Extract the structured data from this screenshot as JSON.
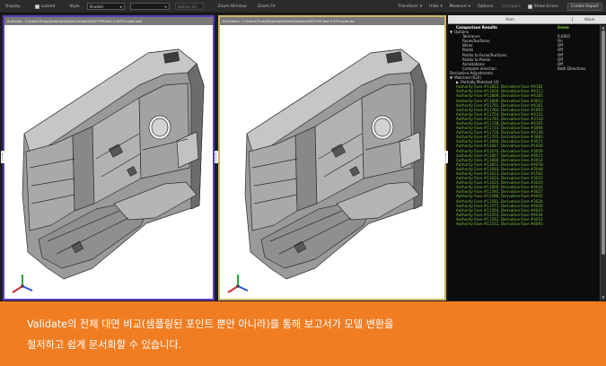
{
  "toolbar": {
    "display_label": "Display",
    "locked_label": "Locked",
    "style_label": "Style",
    "style_value": "Shaded",
    "empty_select_value": "",
    "fixed_label": "Setting 1D",
    "zoom_window_label": "Zoom Window",
    "zoom_fit_label": "Zoom Fit",
    "transform_label": "Transform",
    "hide_label": "Hide",
    "measure_label": "Measure",
    "options_label": "Options",
    "compare_label": "Compare",
    "show_errors_label": "Show Errors",
    "create_report_label": "Create Report"
  },
  "viewports": {
    "left_title": "Authority - C:\\Users\\Trudy\\Desktop\\Models\\Validate\\NIST-PMI-Test-5-AUTH-code.asm",
    "right_title": "Derivative - C:\\Users\\Trudy\\Desktop\\Models\\Validate\\NIST-PMI-Test-5-STP-code.stp"
  },
  "panel": {
    "header_item": "Item",
    "header_value": "Value",
    "rows": [
      {
        "k": "Comparison Results",
        "v": "Same",
        "level": 1,
        "style": "bold",
        "vstyle": "same",
        "exp": ""
      },
      {
        "k": "Options",
        "v": "",
        "level": 0,
        "style": "",
        "exp": "▼"
      },
      {
        "k": "Tolerance",
        "v": "0.0001",
        "level": 2,
        "style": "",
        "exp": ""
      },
      {
        "k": "Faces/Surfaces",
        "v": "On",
        "level": 2,
        "style": "",
        "exp": ""
      },
      {
        "k": "Wires",
        "v": "Off",
        "level": 2,
        "style": "",
        "exp": ""
      },
      {
        "k": "Points",
        "v": "Off",
        "level": 2,
        "style": "",
        "exp": ""
      },
      {
        "k": "Points to Faces/Surfaces",
        "v": "Off",
        "level": 2,
        "style": "",
        "exp": ""
      },
      {
        "k": "Points to Points",
        "v": "Off",
        "level": 2,
        "style": "",
        "exp": ""
      },
      {
        "k": "Annotations",
        "v": "Off",
        "level": 2,
        "style": "",
        "exp": ""
      },
      {
        "k": "Compare direction",
        "v": "Both Directions",
        "level": 2,
        "style": "",
        "exp": ""
      },
      {
        "k": "Derivative Adjustments",
        "v": "",
        "level": 0,
        "style": "",
        "exp": ""
      },
      {
        "k": "Matched (622)",
        "v": "",
        "level": 0,
        "style": "",
        "exp": "▼"
      },
      {
        "k": "Partially Matched (4)",
        "v": "",
        "level": 1,
        "style": "",
        "exp": "▶"
      },
      {
        "k": "Authority Face #11823, Derivative Face #4181",
        "v": "",
        "level": 1,
        "style": "green",
        "exp": ""
      },
      {
        "k": "Authority Face #11816, Derivative Face #4113",
        "v": "",
        "level": 1,
        "style": "green",
        "exp": ""
      },
      {
        "k": "Authority Face #11809, Derivative Face #4185",
        "v": "",
        "level": 1,
        "style": "green",
        "exp": ""
      },
      {
        "k": "Authority Face #11800, Derivative Face #3623",
        "v": "",
        "level": 1,
        "style": "green",
        "exp": ""
      },
      {
        "k": "Authority Face #11791, Derivative Face #4161",
        "v": "",
        "level": 1,
        "style": "green",
        "exp": ""
      },
      {
        "k": "Authority Face #11784, Derivative Face #1663",
        "v": "",
        "level": 1,
        "style": "green",
        "exp": ""
      },
      {
        "k": "Authority Face #11754, Derivative Face #4152",
        "v": "",
        "level": 1,
        "style": "green",
        "exp": ""
      },
      {
        "k": "Authority Face #11745, Derivative Face #3118",
        "v": "",
        "level": 1,
        "style": "green",
        "exp": ""
      },
      {
        "k": "Authority Face #11738, Derivative Face #4165",
        "v": "",
        "level": 1,
        "style": "green",
        "exp": ""
      },
      {
        "k": "Authority Face #11733, Derivative Face #3094",
        "v": "",
        "level": 1,
        "style": "green",
        "exp": ""
      },
      {
        "k": "Authority Face #11726, Derivative Face #4148",
        "v": "",
        "level": 1,
        "style": "green",
        "exp": ""
      },
      {
        "k": "Authority Face #11705, Derivative Face #3083",
        "v": "",
        "level": 1,
        "style": "green",
        "exp": ""
      },
      {
        "k": "Authority Face #11696, Derivative Face #3071",
        "v": "",
        "level": 1,
        "style": "green",
        "exp": ""
      },
      {
        "k": "Authority Face #11687, Derivative Face #1036",
        "v": "",
        "level": 1,
        "style": "green",
        "exp": ""
      },
      {
        "k": "Authority Face #11676, Derivative Face #3059",
        "v": "",
        "level": 1,
        "style": "green",
        "exp": ""
      },
      {
        "k": "Authority Face #11667, Derivative Face #4071",
        "v": "",
        "level": 1,
        "style": "green",
        "exp": ""
      },
      {
        "k": "Authority Face #11660, Derivative Face #3014",
        "v": "",
        "level": 1,
        "style": "green",
        "exp": ""
      },
      {
        "k": "Authority Face #11651, Derivative Face #4078",
        "v": "",
        "level": 1,
        "style": "green",
        "exp": ""
      },
      {
        "k": "Authority Face #11640, Derivative Face #3049",
        "v": "",
        "level": 1,
        "style": "green",
        "exp": ""
      },
      {
        "k": "Authority Face #11633, Derivative Face #1562",
        "v": "",
        "level": 1,
        "style": "green",
        "exp": ""
      },
      {
        "k": "Authority Face #11624, Derivative Face #3015",
        "v": "",
        "level": 1,
        "style": "green",
        "exp": ""
      },
      {
        "k": "Authority Face #11615, Derivative Face #3020",
        "v": "",
        "level": 1,
        "style": "green",
        "exp": ""
      },
      {
        "k": "Authority Face #11600, Derivative Face #4032",
        "v": "",
        "level": 1,
        "style": "green",
        "exp": ""
      },
      {
        "k": "Authority Face #11595, Derivative Face #3027",
        "v": "",
        "level": 1,
        "style": "green",
        "exp": ""
      },
      {
        "k": "Authority Face #11588, Derivative Face #4045",
        "v": "",
        "level": 1,
        "style": "green",
        "exp": ""
      },
      {
        "k": "Authority Face #11581, Derivative Face #3034",
        "v": "",
        "level": 1,
        "style": "green",
        "exp": ""
      },
      {
        "k": "Authority Face #11575, Derivative Face #4020",
        "v": "",
        "level": 1,
        "style": "green",
        "exp": ""
      },
      {
        "k": "Authority Face #11564, Derivative Face #4043",
        "v": "",
        "level": 1,
        "style": "green",
        "exp": ""
      },
      {
        "k": "Authority Face #11553, Derivative Face #4034",
        "v": "",
        "level": 1,
        "style": "green",
        "exp": ""
      },
      {
        "k": "Authority Face #11542, Derivative Face #3014",
        "v": "",
        "level": 1,
        "style": "green",
        "exp": ""
      },
      {
        "k": "Authority Face #11531, Derivative Face #4095",
        "v": "",
        "level": 1,
        "style": "green",
        "exp": ""
      }
    ]
  },
  "caption": {
    "line1": "Validate의 전체 대면 비교(샘플링된 포인트 뿐만 아니라)를 통해 보고서가 모델 변환을",
    "line2": "철저하고 쉽게 문서화할 수 있습니다."
  },
  "colors": {
    "authority_border": "#5a3bbd",
    "derivative_border": "#c9b56a",
    "match_green": "#7bc63b",
    "banner": "#f07d22"
  }
}
